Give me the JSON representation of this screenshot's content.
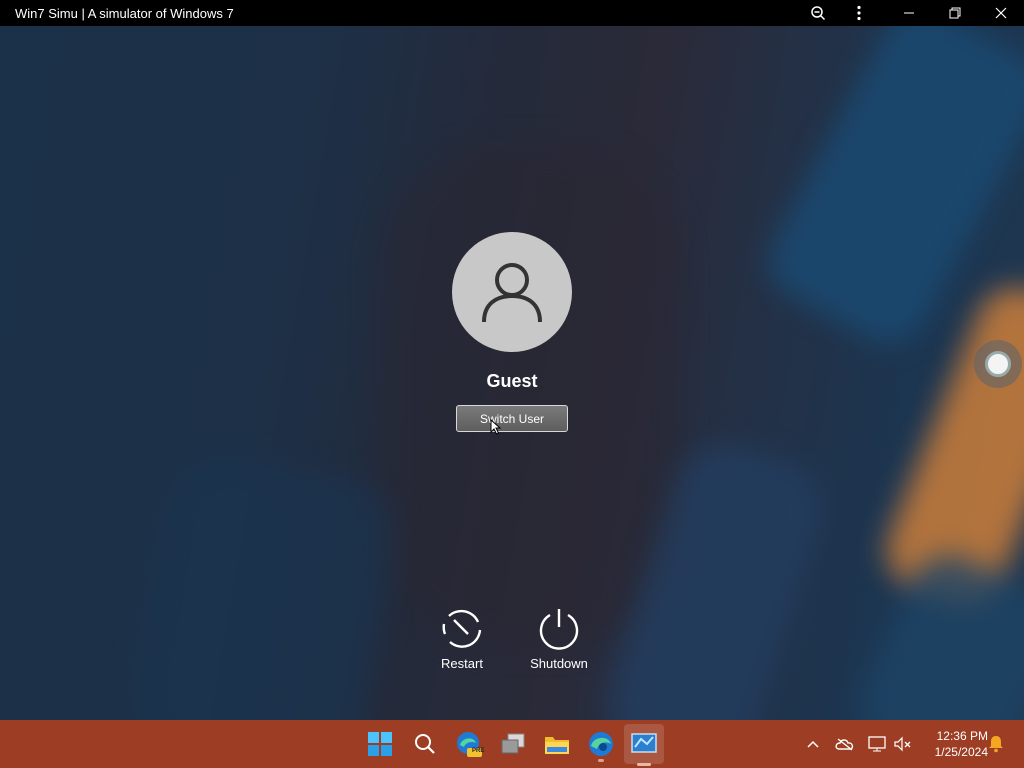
{
  "window": {
    "title": "Win7 Simu | A simulator of Windows 7"
  },
  "login": {
    "username": "Guest",
    "switch_user_label": "Switch User",
    "restart_label": "Restart",
    "shutdown_label": "Shutdown"
  },
  "taskbar": {
    "apps": [
      "windows-start-icon",
      "search-icon",
      "edge-preview-icon",
      "virtual-desktop-icon",
      "file-explorer-icon",
      "edge-icon",
      "win7-simu-icon"
    ],
    "tray": [
      "chevron-up-icon",
      "onedrive-icon",
      "network-icon",
      "volume-muted-icon",
      "notification-bell-icon"
    ],
    "clock": {
      "time": "12:36 PM",
      "date": "1/25/2024"
    },
    "edge_preview_badge": "PRE"
  },
  "colors": {
    "taskbar": "#9c3d24",
    "titlebar": "#000000",
    "avatar": "#c8c8c8"
  }
}
